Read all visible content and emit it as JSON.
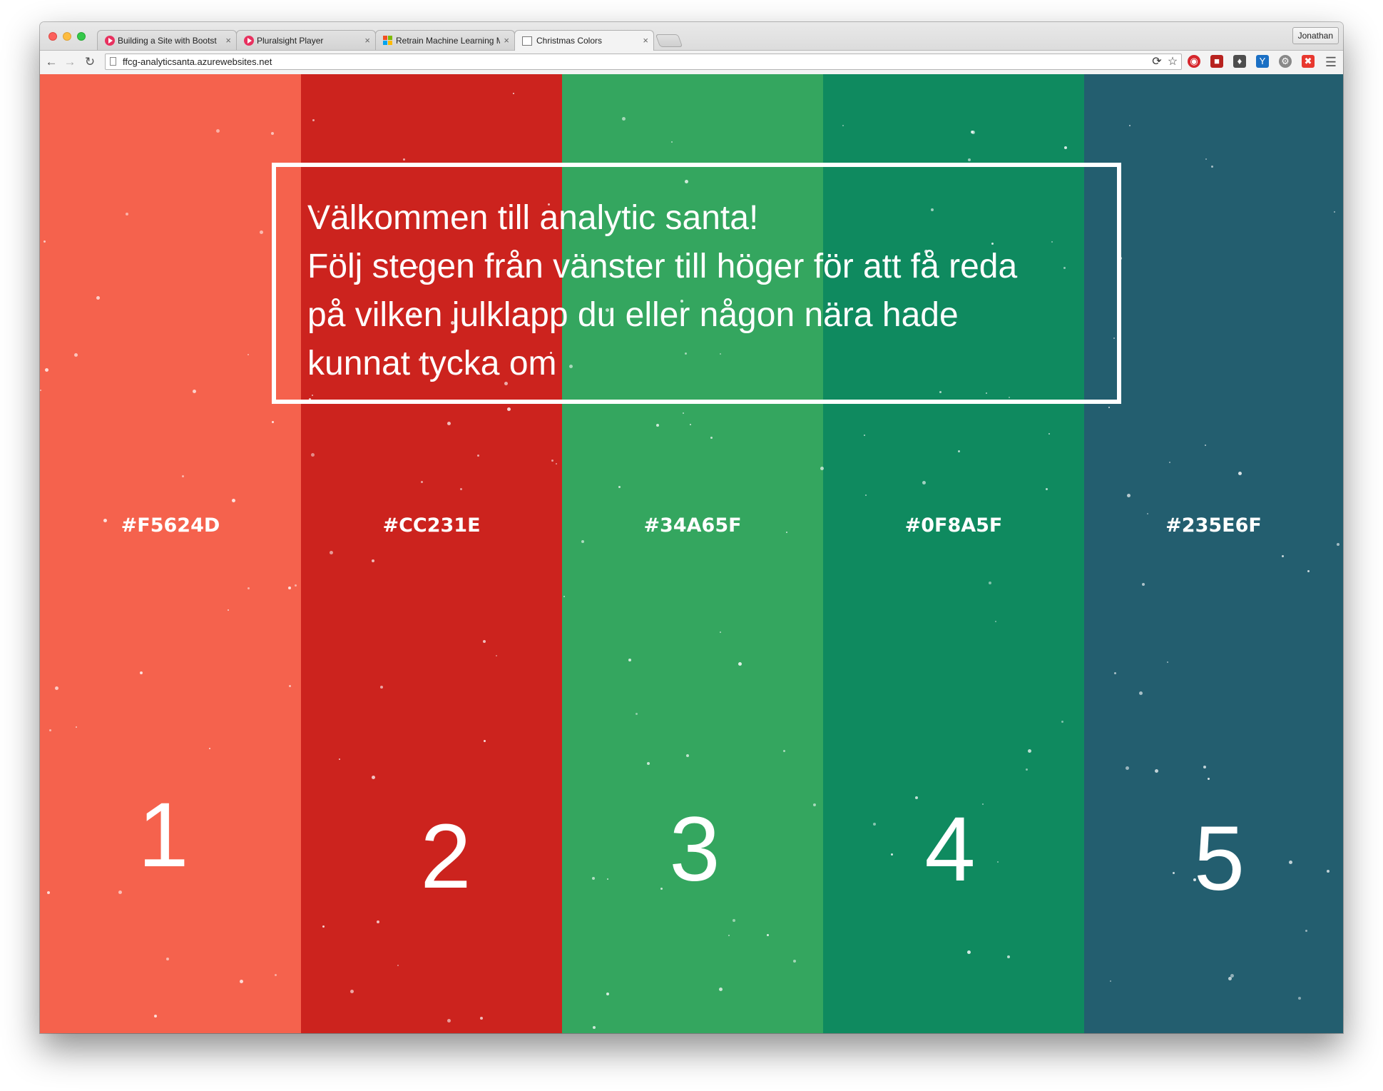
{
  "browser": {
    "tabs": [
      {
        "title": "Building a Site with Bootst",
        "favicon": "pluralsight-icon",
        "active": false
      },
      {
        "title": "Pluralsight Player",
        "favicon": "pluralsight-icon",
        "active": false
      },
      {
        "title": "Retrain Machine Learning M",
        "favicon": "microsoft-icon",
        "active": false
      },
      {
        "title": "Christmas Colors",
        "favicon": "page-icon",
        "active": true
      }
    ],
    "tab_close_glyph": "×",
    "profile_name": "Jonathan",
    "url": "ffcg-analyticsanta.azurewebsites.net"
  },
  "page": {
    "welcome_lines": [
      "Välkommen till analytic santa!",
      "Följ stegen från vänster till höger för att få reda",
      "på vilken julklapp du eller någon nära hade",
      "kunnat tycka om"
    ],
    "columns": [
      {
        "hex": "#F5624D",
        "number": "1",
        "color": "#F5624D"
      },
      {
        "hex": "#CC231E",
        "number": "2",
        "color": "#CC231E"
      },
      {
        "hex": "#34A65F",
        "number": "3",
        "color": "#34A65F"
      },
      {
        "hex": "#0F8A5F",
        "number": "4",
        "color": "#0F8A5F"
      },
      {
        "hex": "#235E6F",
        "number": "5",
        "color": "#235E6F"
      }
    ]
  }
}
